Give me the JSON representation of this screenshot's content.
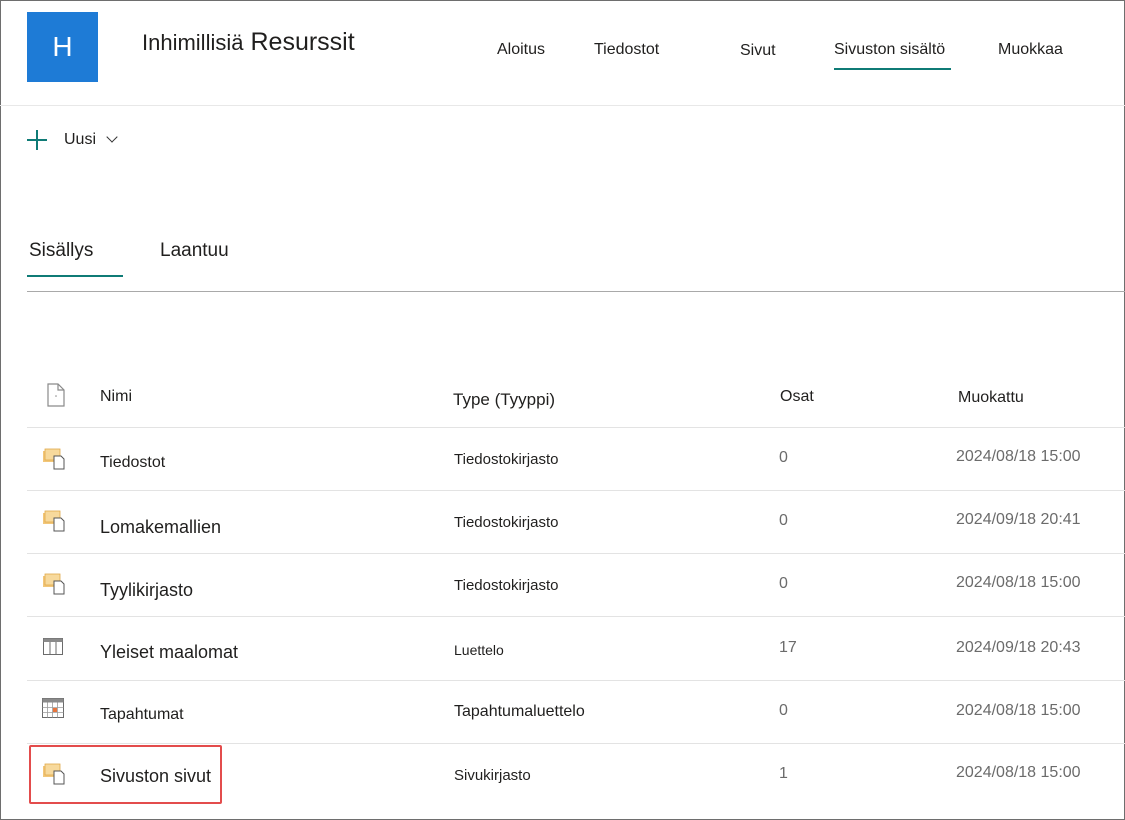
{
  "colors": {
    "brand": "#1e7bd6",
    "accent": "#0f7b76",
    "highlight": "#e34c4c"
  },
  "site": {
    "logo_letter": "H",
    "title_part1": "Inhimillisiä",
    "title_part2": "Resurssit"
  },
  "nav": [
    {
      "label": "Aloitus"
    },
    {
      "label": "Tiedostot"
    },
    {
      "label": "Sivut"
    },
    {
      "label": "Sivuston sisältö",
      "active": true
    },
    {
      "label": "Muokkaa"
    }
  ],
  "command_bar": {
    "new_label": "Uusi"
  },
  "tabs": [
    {
      "label": "Sisällys",
      "active": true
    },
    {
      "label": "Laantuu"
    }
  ],
  "table": {
    "headers": {
      "name": "Nimi",
      "type": "Type (Tyyppi)",
      "count": "Osat",
      "modified": "Muokattu"
    },
    "rows": [
      {
        "icon": "document-library-icon",
        "name": "Tiedostot",
        "type": "Tiedostokirjasto",
        "count": "0",
        "modified": "2024/08/18 15:00"
      },
      {
        "icon": "document-library-icon",
        "name": "Lomakemallien",
        "type": "Tiedostokirjasto",
        "count": "0",
        "modified": "2024/09/18 20:41"
      },
      {
        "icon": "document-library-icon",
        "name": "Tyylikirjasto",
        "type": "Tiedostokirjasto",
        "count": "0",
        "modified": "2024/08/18 15:00"
      },
      {
        "icon": "list-icon",
        "name": "Yleiset maalomat",
        "type": "Luettelo",
        "count": "17",
        "modified": "2024/09/18 20:43"
      },
      {
        "icon": "calendar-icon",
        "name": "Tapahtumat",
        "type": "Tapahtumaluettelo",
        "count": "0",
        "modified": "2024/08/18 15:00"
      },
      {
        "icon": "document-library-icon",
        "name": "Sivuston sivut",
        "type": "Sivukirjasto",
        "count": "1",
        "modified": "2024/08/18 15:00",
        "highlighted": true
      }
    ]
  }
}
